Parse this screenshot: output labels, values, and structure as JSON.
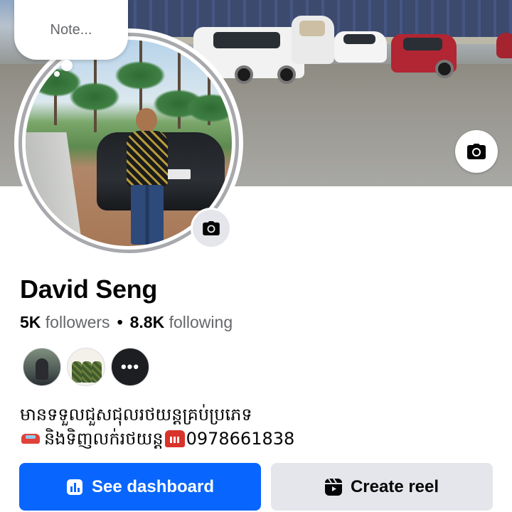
{
  "note": {
    "placeholder": "Note..."
  },
  "profile": {
    "name": "David Seng",
    "followers_count": "5K",
    "followers_label": "followers",
    "separator": "•",
    "following_count": "8.8K",
    "following_label": "following"
  },
  "mutual_friends": {
    "more_label": "•••"
  },
  "bio": {
    "line1": "មានទទួលជួសជុលរថយន្តគ្រប់ប្រភេទ",
    "line2_text": "និងទិញលក់រថយន្ត",
    "phone": "0978661838"
  },
  "actions": {
    "dashboard_label": "See dashboard",
    "create_reel_label": "Create reel"
  },
  "icons": {
    "cover_camera": "camera-icon",
    "avatar_camera": "camera-icon",
    "dashboard": "bar-chart-icon",
    "reel": "reel-icon"
  },
  "colors": {
    "primary": "#0866ff",
    "secondary_button": "#e4e6eb",
    "muted_text": "#65676b"
  }
}
